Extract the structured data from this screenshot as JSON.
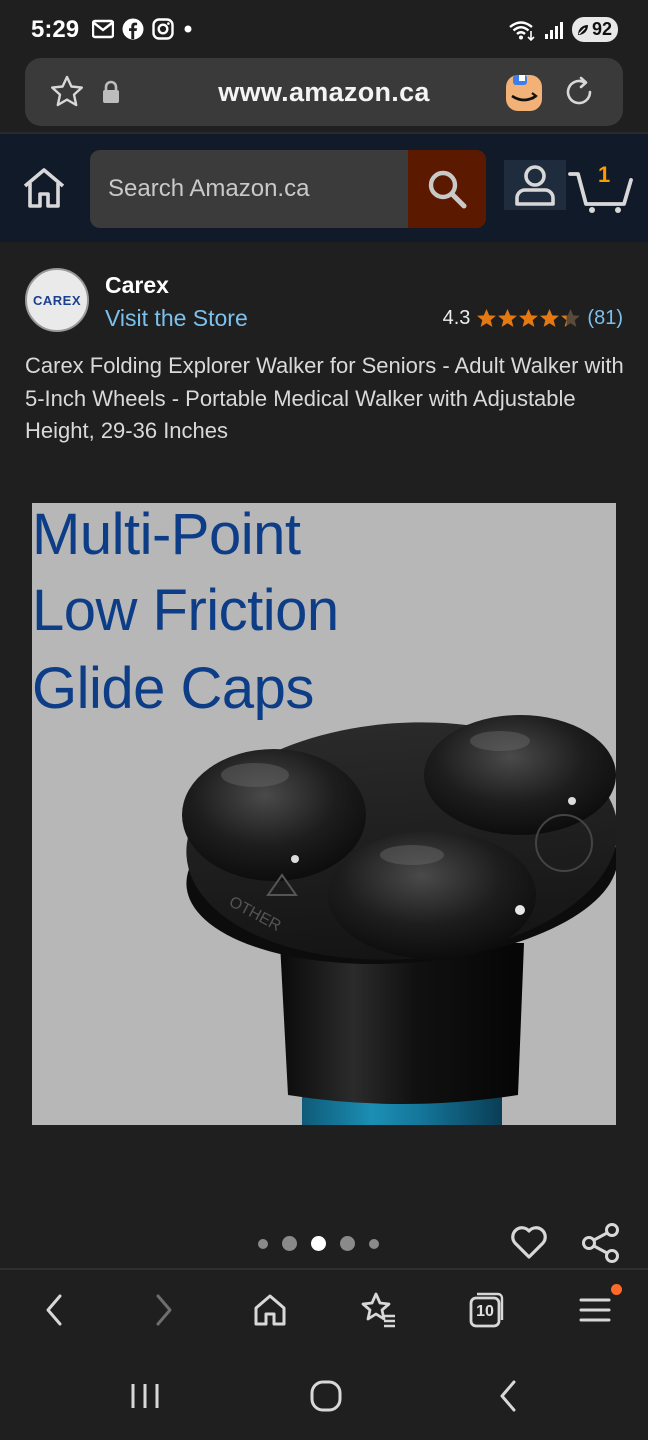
{
  "status_bar": {
    "time": "5:29",
    "battery": "92",
    "icons_left": [
      "mail-icon",
      "facebook-icon",
      "instagram-icon",
      "dot-icon"
    ],
    "icons_right": [
      "wifi-icon",
      "signal-icon",
      "battery-icon"
    ]
  },
  "browser": {
    "url": "www.amazon.ca",
    "tab_count": "10"
  },
  "amazon_header": {
    "search_placeholder": "Search Amazon.ca",
    "cart_count": "1"
  },
  "product": {
    "brand": "Carex",
    "brand_logo_text": "CAREX",
    "visit_store": "Visit the Store",
    "rating": "4.3",
    "rating_value": 4.3,
    "review_count": "(81)",
    "title": "Carex Folding Explorer Walker for Seniors - Adult Walker with 5-Inch Wheels - Portable Medical Walker with Adjustable Height, 29-36 Inches",
    "image_caption_lines": [
      "Multi-Point",
      "Low Friction",
      "Glide Caps"
    ],
    "image_embossed_text": "OTHER",
    "carousel_total": 5,
    "carousel_active": 3
  },
  "colors": {
    "header_bg": "#101a29",
    "search_btn": "#5b1a00",
    "link": "#7cc1ec",
    "star": "#e47911",
    "caption_blue": "#0d3d86",
    "cart_count": "#ff9900"
  }
}
